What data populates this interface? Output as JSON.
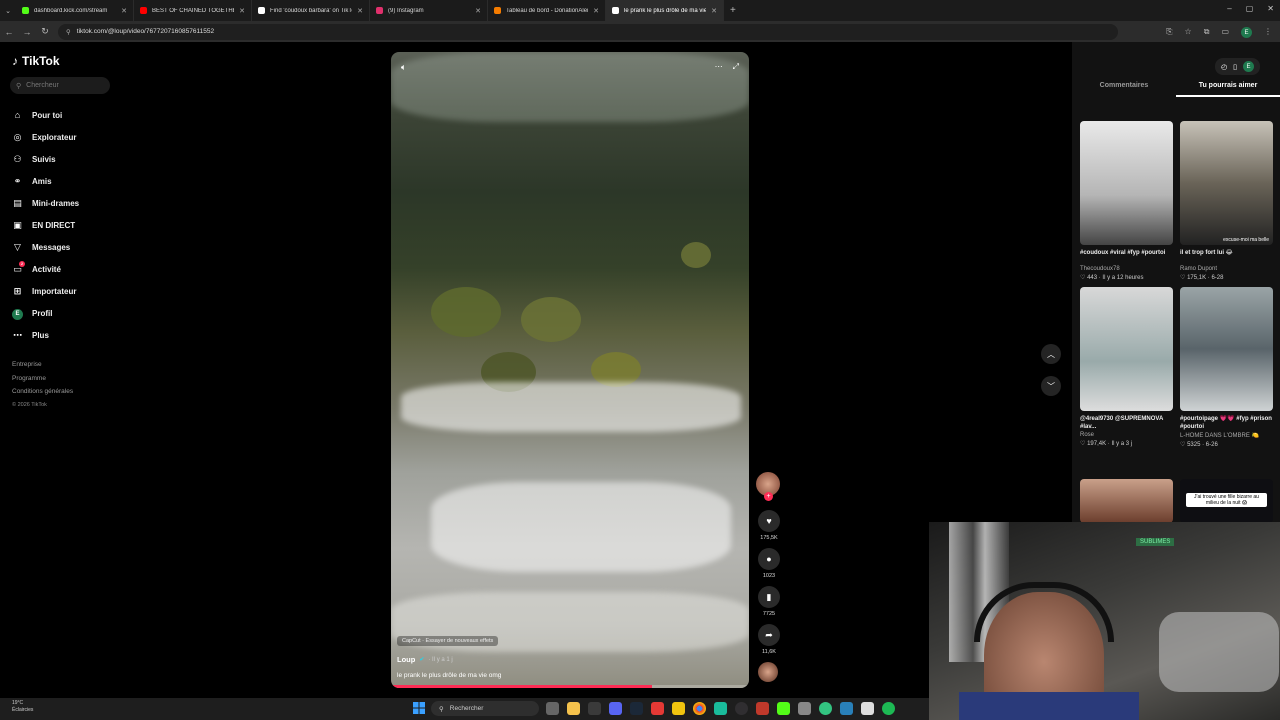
{
  "browser": {
    "tabs": [
      {
        "title": "dashboard.kick.com/stream",
        "color": "#53fc18"
      },
      {
        "title": "BEST OF CHAINED TOGETHER",
        "color": "#ff0000"
      },
      {
        "title": "Find 'coudoux barbara' on TikTok",
        "color": "#ffffff"
      },
      {
        "title": "(9) Instagram",
        "color": "#e1306c"
      },
      {
        "title": "Tableau de bord - DonationAlerts",
        "color": "#f57c00"
      },
      {
        "title": "le prank le plus drôle de ma vie",
        "color": "#ffffff",
        "active": true
      }
    ],
    "url": "tiktok.com/@loup/video/7677207160857611552"
  },
  "sidebar": {
    "logo": "TikTok",
    "search_placeholder": "Chercheur",
    "items": [
      {
        "label": "Pour toi",
        "icon": "home-icon"
      },
      {
        "label": "Explorateur",
        "icon": "compass-icon"
      },
      {
        "label": "Suivis",
        "icon": "following-icon"
      },
      {
        "label": "Amis",
        "icon": "friends-icon"
      },
      {
        "label": "Mini-drames",
        "icon": "mini-drama-icon"
      },
      {
        "label": "EN DIRECT",
        "icon": "live-icon"
      },
      {
        "label": "Messages",
        "icon": "messages-icon"
      },
      {
        "label": "Activité",
        "icon": "activity-icon",
        "badge": "2"
      },
      {
        "label": "Importateur",
        "icon": "upload-icon"
      },
      {
        "label": "Profil",
        "icon": "profile-icon"
      },
      {
        "label": "Plus",
        "icon": "more-icon"
      }
    ],
    "footer": [
      "Entreprise",
      "Programme",
      "Conditions générales"
    ],
    "copyright": "© 2026 TikTok"
  },
  "video": {
    "capcut": "CapCut · Essayer de nouveaux effets",
    "author": "Loup",
    "time": "· Il y a 1 j",
    "caption": "le prank le plus drôle de ma vie omg",
    "progress": 0.73
  },
  "actions": {
    "likes": "175,5K",
    "comments": "1023",
    "saves": "7725",
    "shares": "11,6K"
  },
  "right_panel": {
    "tabs": [
      "Commentaires",
      "Tu pourrais aimer"
    ],
    "active_tab": 1,
    "cards": [
      {
        "title": "#coudoux #viral #fyp #pourtoi",
        "user": "Thecoudoux78",
        "likes": "443",
        "time": "Il y a 12 heures",
        "bg": "linear-gradient(#e9e9e9,#b5b5b5 60%,#444)"
      },
      {
        "title": "il et trop fort lui 😂",
        "user": "Ramo Dupont",
        "likes": "175,1K",
        "time": "6-28",
        "bg": "linear-gradient(#c7c2b8,#6a6458 50%,#222)",
        "overlay": "excuse-moi ma belle"
      },
      {
        "title": "@4real9730 @SUPREMNOVA #lav...",
        "user": "Rose",
        "likes": "197,4K",
        "time": "Il y a 3 j",
        "bg": "linear-gradient(#d8d8d8,#9aa 60%,#ddd)"
      },
      {
        "title": "#pourtoipage 💗💗 #fyp #prison #pourtoi",
        "user": "L-HOME DANS L'OMBRE 🍋",
        "likes": "5325",
        "time": "6-26",
        "bg": "linear-gradient(#9aa4a6,#59646a 50%,#cfd3d4)"
      }
    ],
    "partial_overlay": "J'ai trouvé une fille bizarre au milieu de la nuit 😱"
  },
  "webcam": {
    "tag": "SUBLIMES"
  },
  "taskbar": {
    "weather_temp": "19°C",
    "weather_desc": "Éclaircies",
    "search": "Rechercher"
  }
}
